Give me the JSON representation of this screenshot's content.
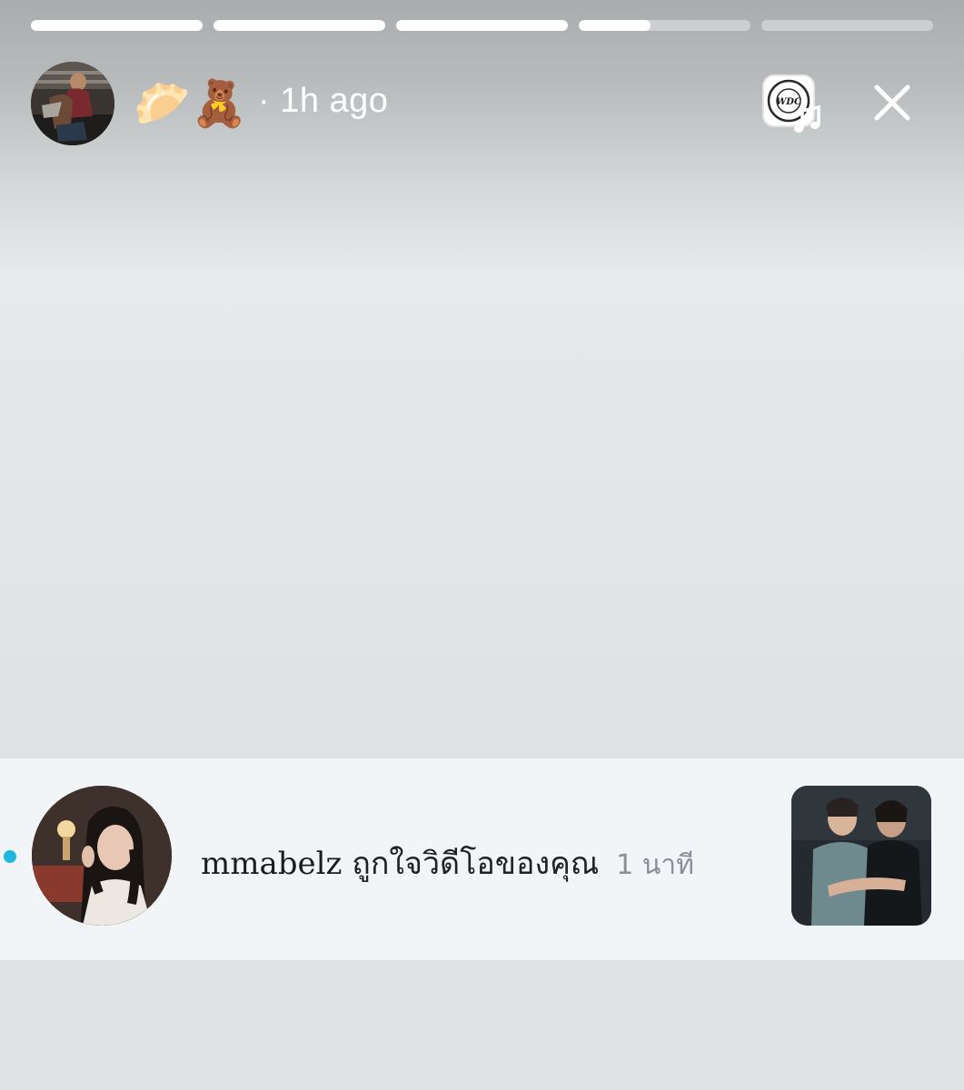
{
  "story": {
    "progress": [
      1,
      1,
      1,
      0.42,
      0
    ],
    "emoji_1": "🥟",
    "emoji_2": "🧸",
    "time": "· 1h ago",
    "music_badge_text": "WDC"
  },
  "notification": {
    "username": "mmabelz",
    "message": "ถูกใจวิดีโอของคุณ",
    "time": "1 นาที",
    "unread_color": "#1fb6e0"
  },
  "icons": {
    "close": "close-icon",
    "music": "music-note-icon"
  }
}
